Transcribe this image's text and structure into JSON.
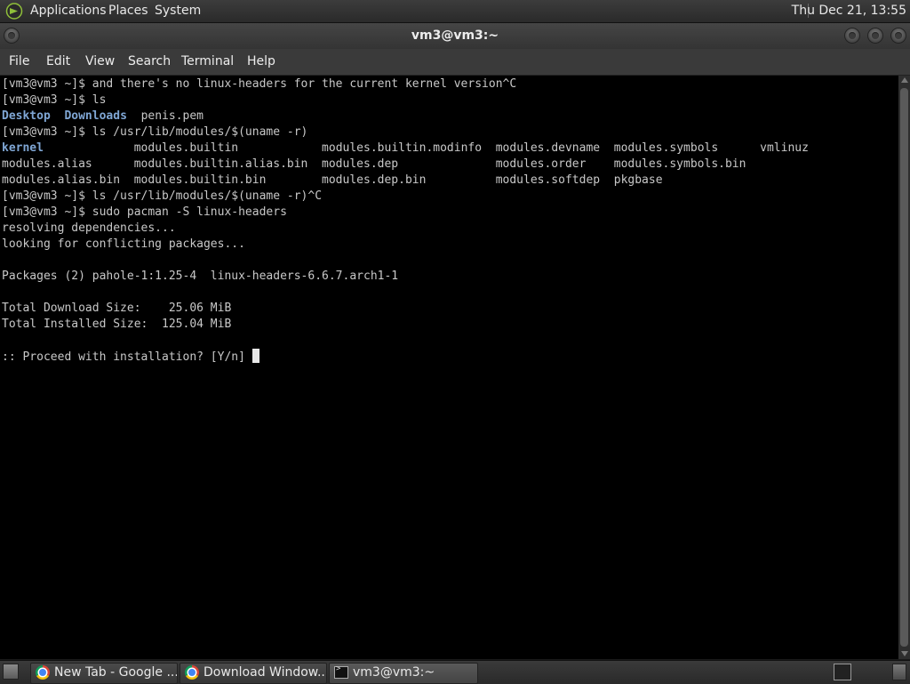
{
  "top_panel": {
    "menus": [
      "Applications",
      "Places",
      "System"
    ],
    "clock": "Thu Dec 21, 13:55"
  },
  "window": {
    "title": "vm3@vm3:~"
  },
  "menubar": {
    "items": [
      "File",
      "Edit",
      "View",
      "Search",
      "Terminal",
      "Help"
    ]
  },
  "terminal": {
    "lines": [
      "[vm3@vm3 ~]$ and there's no linux-headers for the current kernel version^C",
      "[vm3@vm3 ~]$ ls",
      "Desktop  Downloads  penis.pem",
      "[vm3@vm3 ~]$ ls /usr/lib/modules/$(uname -r)",
      "kernel             modules.builtin            modules.builtin.modinfo  modules.devname  modules.symbols      vmlinuz",
      "modules.alias      modules.builtin.alias.bin  modules.dep              modules.order    modules.symbols.bin",
      "modules.alias.bin  modules.builtin.bin        modules.dep.bin          modules.softdep  pkgbase",
      "[vm3@vm3 ~]$ ls /usr/lib/modules/$(uname -r)^C",
      "[vm3@vm3 ~]$ sudo pacman -S linux-headers",
      "resolving dependencies...",
      "looking for conflicting packages...",
      "",
      "Packages (2) pahole-1:1.25-4  linux-headers-6.6.7.arch1-1",
      "",
      "Total Download Size:    25.06 MiB",
      "Total Installed Size:  125.04 MiB",
      "",
      ":: Proceed with installation? [Y/n] "
    ],
    "directories": [
      "Desktop",
      "Downloads",
      "kernel"
    ]
  },
  "taskbar": {
    "tasks": [
      {
        "label": "New Tab - Google ...",
        "icon": "chrome-icon"
      },
      {
        "label": "Download Window...",
        "icon": "chrome-icon"
      },
      {
        "label": "vm3@vm3:~",
        "icon": "terminal-icon"
      }
    ]
  },
  "colors": {
    "terminal_bg": "#000000",
    "terminal_fg": "#c8c8c8",
    "directory": "#7fa6d4",
    "panel": "#333333"
  }
}
